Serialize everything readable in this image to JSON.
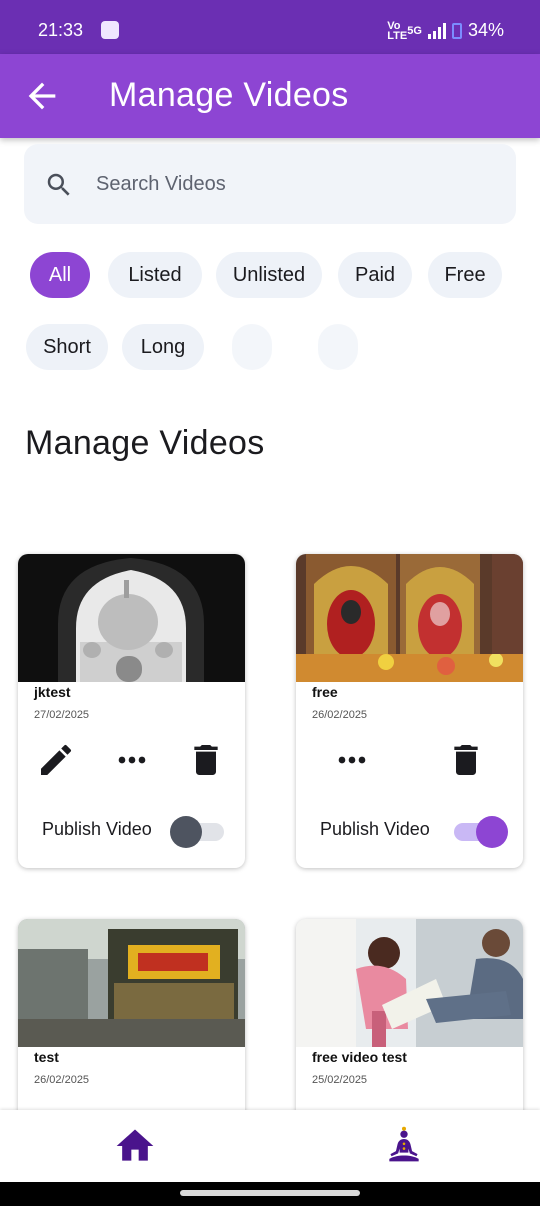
{
  "status_bar": {
    "time": "21:33",
    "network": "5G",
    "volte": "Vo LTE",
    "battery": "34%"
  },
  "app_bar": {
    "title": "Manage Videos"
  },
  "search": {
    "placeholder": "Search Videos"
  },
  "filters": [
    "All",
    "Listed",
    "Unlisted",
    "Paid",
    "Free",
    "Short",
    "Long"
  ],
  "active_filter": "All",
  "section_title": "Manage Videos",
  "videos": [
    {
      "title": "jktest",
      "date": "27/02/2025",
      "publish_label": "Publish Video",
      "published": false,
      "editable": true
    },
    {
      "title": "free",
      "date": "26/02/2025",
      "publish_label": "Publish Video",
      "published": true,
      "editable": false
    },
    {
      "title": "test",
      "date": "26/02/2025"
    },
    {
      "title": "free video test",
      "date": "25/02/2025"
    }
  ],
  "colors": {
    "primary": "#8d45d3",
    "status_bar": "#6b2fb3",
    "chip_bg": "#eef2f8",
    "nav_icon": "#4a148c"
  }
}
